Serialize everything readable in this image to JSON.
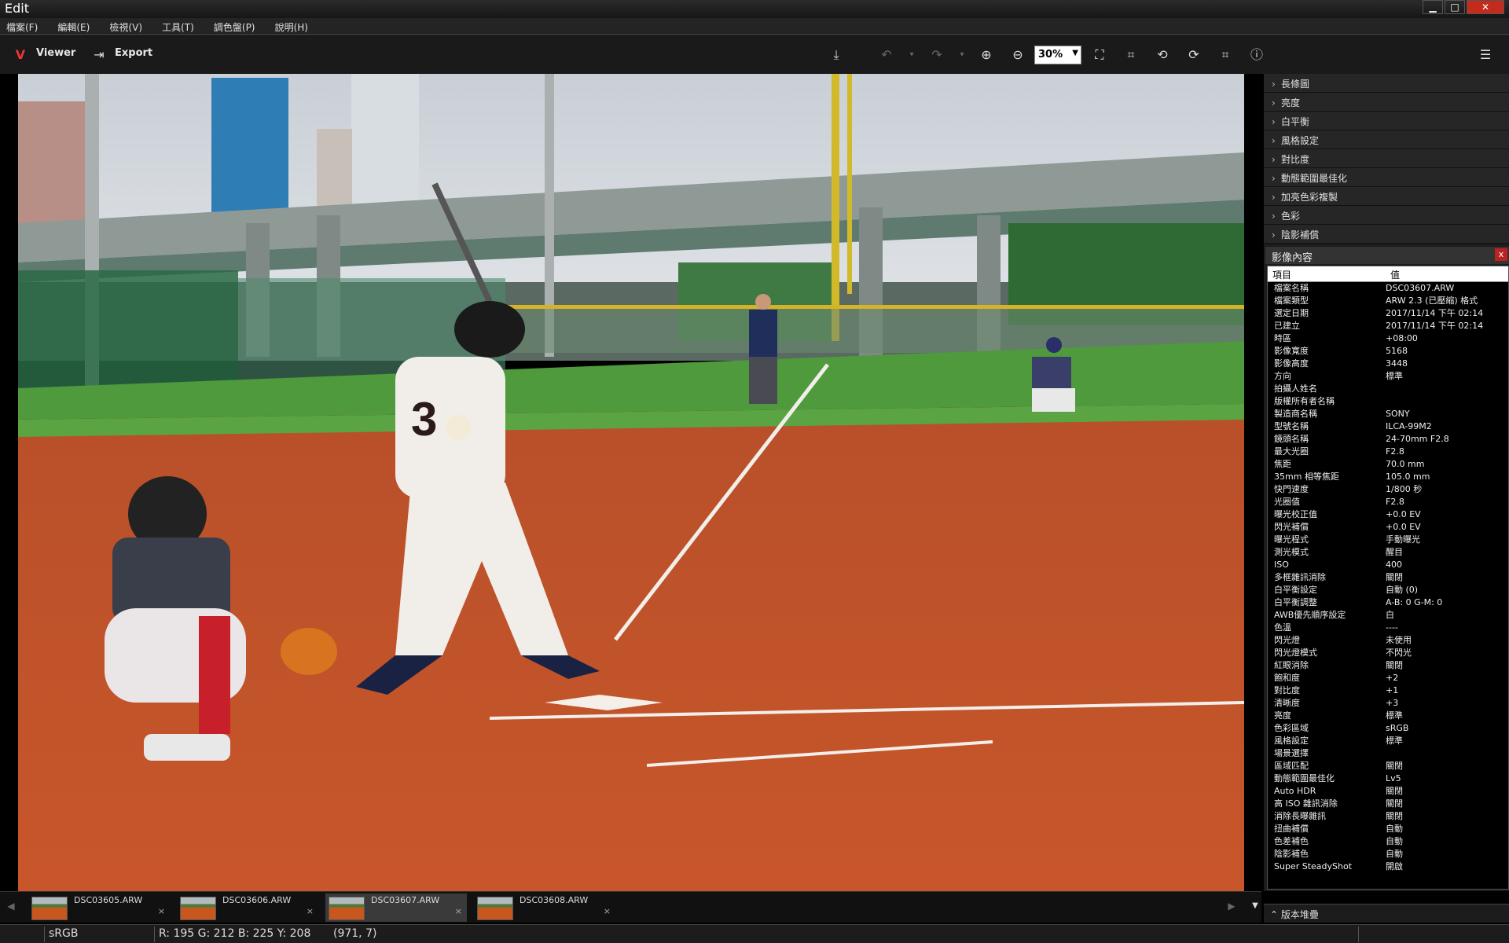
{
  "window": {
    "title": "Edit",
    "min": "▁",
    "max": "□",
    "close": "✕"
  },
  "menu": [
    "檔案(F)",
    "編輯(E)",
    "檢視(V)",
    "工具(T)",
    "調色盤(P)",
    "說明(H)"
  ],
  "toolbar": {
    "viewer_label": "Viewer",
    "export_label": "Export",
    "zoom_value": "30%"
  },
  "panel": {
    "sections": [
      "長條圖",
      "亮度",
      "白平衡",
      "風格設定",
      "對比度",
      "動態範圍最佳化",
      "加亮色彩複製",
      "色彩",
      "陰影補償"
    ],
    "props_title": "影像內容",
    "col_item": "項目",
    "col_value": "值",
    "rows": [
      [
        "檔案名稱",
        "DSC03607.ARW"
      ],
      [
        "檔案類型",
        "ARW 2.3 (已壓縮) 格式"
      ],
      [
        "選定日期",
        "2017/11/14 下午 02:14"
      ],
      [
        "已建立",
        "2017/11/14 下午 02:14"
      ],
      [
        "時區",
        "+08:00"
      ],
      [
        "影像寬度",
        "5168"
      ],
      [
        "影像高度",
        "3448"
      ],
      [
        "方向",
        "標準"
      ],
      [
        "拍攝人姓名",
        ""
      ],
      [
        "版權所有者名稱",
        ""
      ],
      [
        "製造商名稱",
        "SONY"
      ],
      [
        "型號名稱",
        "ILCA-99M2"
      ],
      [
        "鏡頭名稱",
        "24-70mm F2.8"
      ],
      [
        "最大光圈",
        "F2.8"
      ],
      [
        "焦距",
        "70.0 mm"
      ],
      [
        "35mm 相等焦距",
        "105.0 mm"
      ],
      [
        "快門速度",
        "1/800 秒"
      ],
      [
        "光圈值",
        "F2.8"
      ],
      [
        "曝光校正值",
        "+0.0 EV"
      ],
      [
        "閃光補償",
        "+0.0 EV"
      ],
      [
        "曝光程式",
        "手動曝光"
      ],
      [
        "測光模式",
        "醒目"
      ],
      [
        "ISO",
        "400"
      ],
      [
        "多框雜訊消除",
        "關閉"
      ],
      [
        "白平衡設定",
        "自動 (0)"
      ],
      [
        "白平衡調整",
        "A-B: 0 G-M: 0"
      ],
      [
        "AWB優先順序設定",
        "白"
      ],
      [
        "色溫",
        "----"
      ],
      [
        "閃光燈",
        "未使用"
      ],
      [
        "閃光燈模式",
        "不閃光"
      ],
      [
        "紅眼消除",
        "關閉"
      ],
      [
        "飽和度",
        "+2"
      ],
      [
        "對比度",
        "+1"
      ],
      [
        "清晰度",
        "+3"
      ],
      [
        "亮度",
        "標準"
      ],
      [
        "色彩區域",
        "sRGB"
      ],
      [
        "風格設定",
        "標準"
      ],
      [
        "場景選擇",
        ""
      ],
      [
        "區域匹配",
        "關閉"
      ],
      [
        "動態範圍最佳化",
        "Lv5"
      ],
      [
        "Auto HDR",
        "關閉"
      ],
      [
        "高 ISO 雜訊消除",
        "關閉"
      ],
      [
        "消除長曝雜訊",
        "關閉"
      ],
      [
        "扭曲補償",
        "自動"
      ],
      [
        "色差補色",
        "自動"
      ],
      [
        "陰影補色",
        "自動"
      ],
      [
        "Super SteadyShot",
        "開啟"
      ]
    ],
    "version_stack_label": "版本堆疊"
  },
  "filmstrip": [
    "DSC03605.ARW",
    "DSC03606.ARW",
    "DSC03607.ARW",
    "DSC03608.ARW"
  ],
  "status": {
    "colorspace": "sRGB",
    "pixel": "R: 195  G: 212  B: 225  Y: 208",
    "coords": "(971,   7)"
  }
}
